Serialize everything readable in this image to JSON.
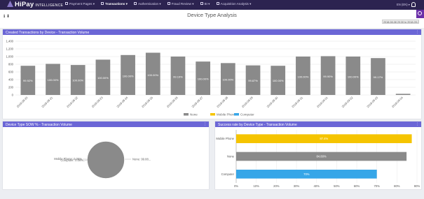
{
  "brand": {
    "name": "HiPay",
    "sub": "INTELLIGENCE"
  },
  "nav": [
    {
      "label": "Payment Pages ▾",
      "active": false
    },
    {
      "label": "Transactions ▾",
      "active": true
    },
    {
      "label": "Authentication ▾",
      "active": false
    },
    {
      "label": "Fraud Review ▾",
      "active": false
    },
    {
      "label": "BI ▾",
      "active": false
    },
    {
      "label": "Acquisition Analysis ▾",
      "active": false
    }
  ],
  "header": {
    "lang": "EN (EN) ▾",
    "title": "Device Type Analysis",
    "date_range": "2018-08-08 20:30 to 2018-09-30 20:30 ▾",
    "tool_icons": "ℹ ⬇"
  },
  "colors": {
    "accent": "#6b66d6",
    "none": "#8a8a8a",
    "mobile": "#f5c400",
    "computer": "#36a6e8",
    "topbar": "#2c2350"
  },
  "panels": {
    "main": {
      "title": "Created Transactions by Device - Transaction Volume",
      "opt": "⋮"
    },
    "sow": {
      "title": "Device Type SOW % - Transaction Volume",
      "opt": "⋮"
    },
    "success": {
      "title": "Success rate by Device Type - Transaction Volume",
      "opt": "⋮"
    }
  },
  "chart_data": [
    {
      "type": "bar",
      "categories": [
        "2018-08-20",
        "2018-08-21",
        "2018-08-22",
        "2018-08-23",
        "2018-08-24",
        "2018-08-25",
        "2018-08-26",
        "2018-08-27",
        "2018-08-28",
        "2018-08-29",
        "2018-08-30",
        "2018-08-31",
        "2018-09-01",
        "2018-09-02",
        "2018-09-03",
        "2018-09-04"
      ],
      "y_ticks": [
        "0",
        "200",
        "400",
        "600",
        "800",
        "1,000",
        "1,200",
        "1,400"
      ],
      "ylim": [
        0,
        1400
      ],
      "series": [
        {
          "name": "None",
          "values": [
            760,
            810,
            780,
            920,
            1040,
            1100,
            1000,
            870,
            830,
            770,
            760,
            1000,
            1010,
            1000,
            960,
            30
          ]
        },
        {
          "name": "Mobile Phone",
          "values": [
            0,
            0,
            0,
            0,
            0,
            0,
            0,
            0,
            0,
            0,
            0,
            0,
            0,
            0,
            0,
            0
          ]
        },
        {
          "name": "Computer",
          "values": [
            0,
            0,
            0,
            0,
            0,
            0,
            0,
            0,
            0,
            0,
            0,
            0,
            0,
            0,
            0,
            0
          ]
        }
      ],
      "bar_labels": [
        "99.92%",
        "100.00%",
        "100.00%",
        "100.00%",
        "100.00%",
        "100.00%",
        "99.19%",
        "100.00%",
        "100.00%",
        "99.87%",
        "100.00%",
        "100.00%",
        "99.90%",
        "100.00%",
        "99.17%",
        ""
      ]
    },
    {
      "type": "pie",
      "labels": [
        "None: 99.88...",
        "Mobile Phone: 0.06%",
        "Computer: 0.06%"
      ],
      "values": [
        99.88,
        0.06,
        0.06
      ]
    },
    {
      "type": "bar",
      "orientation": "horizontal",
      "categories": [
        "Mobile Phone",
        "None",
        "Computer"
      ],
      "values": [
        87.4,
        84.8,
        70.0
      ],
      "bar_labels": [
        "87.4%",
        "84.80%",
        "70%"
      ],
      "x_ticks": [
        "0%",
        "10%",
        "20%",
        "30%",
        "40%",
        "50%",
        "60%",
        "70%",
        "80%",
        "90%"
      ],
      "xlim": [
        0,
        90
      ]
    }
  ]
}
